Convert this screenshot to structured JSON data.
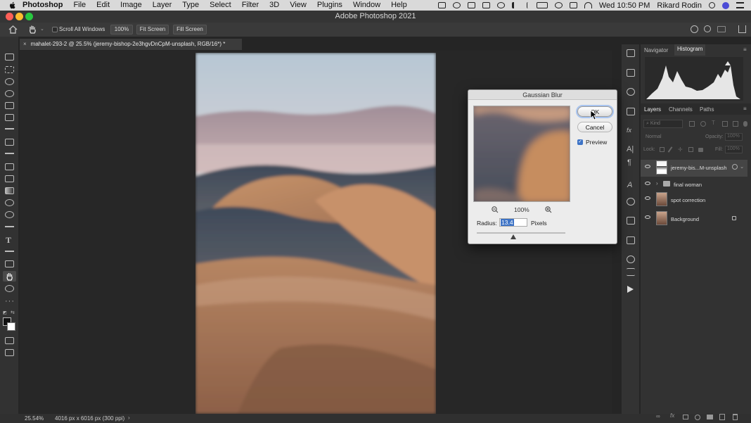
{
  "menubar": {
    "app_name": "Photoshop",
    "items": [
      "File",
      "Edit",
      "Image",
      "Layer",
      "Type",
      "Select",
      "Filter",
      "3D",
      "View",
      "Plugins",
      "Window",
      "Help"
    ],
    "datetime": "Wed 10:50 PM",
    "user": "Rikard Rodin"
  },
  "window_title": "Adobe Photoshop 2021",
  "options_bar": {
    "scroll_all_label": "Scroll All Windows",
    "zoom_button": "100%",
    "fit_screen_button": "Fit Screen",
    "fill_screen_button": "Fill Screen"
  },
  "document_tab": "mahalet-293-2 @ 25.5% (jeremy-bishop-2e3hgvDnCpM-unsplash, RGB/16*) *",
  "status_bar": {
    "zoom": "25.54%",
    "doc_info": "4016 px x 6016 px (300 ppi)"
  },
  "panels": {
    "top_tabs": [
      "Navigator",
      "Histogram"
    ],
    "top_active": "Histogram",
    "layer_tabs": [
      "Layers",
      "Channels",
      "Paths"
    ],
    "layers_active": "Layers",
    "kind_placeholder": "Kind",
    "blend_mode": "Normal",
    "opacity_label": "Opacity:",
    "opacity_value": "100%",
    "lock_label": "Lock:",
    "fill_label": "Fill:",
    "fill_value": "100%",
    "layers": [
      {
        "name": "jeremy-bis...M-unsplash"
      },
      {
        "name": "final woman"
      },
      {
        "name": "spot correction"
      },
      {
        "name": "Background"
      }
    ]
  },
  "dialog": {
    "title": "Gaussian Blur",
    "ok_label": "OK",
    "cancel_label": "Cancel",
    "preview_label": "Preview",
    "preview_checked": true,
    "zoom_value": "100%",
    "radius_label": "Radius:",
    "radius_value": "13.4",
    "unit_label": "Pixels"
  },
  "colors": {
    "accent": "#3d73c6",
    "panel_bg": "#323232",
    "canvas_bg": "#272727"
  }
}
